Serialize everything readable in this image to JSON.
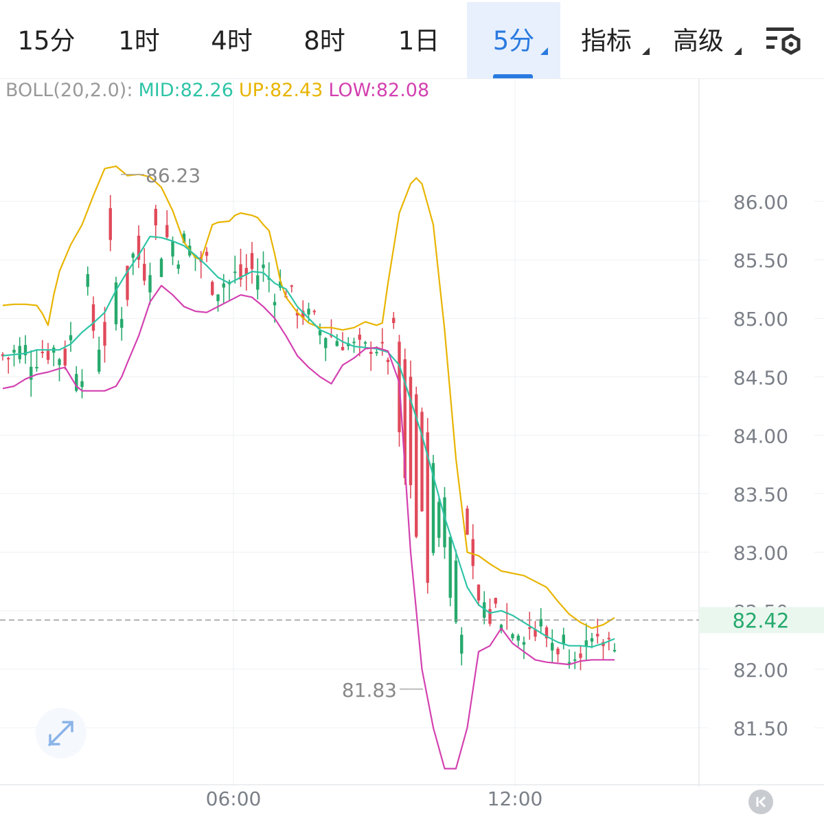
{
  "tabs": [
    {
      "label": "15分",
      "active": false,
      "dropdown": false
    },
    {
      "label": "1时",
      "active": false,
      "dropdown": false
    },
    {
      "label": "4时",
      "active": false,
      "dropdown": false
    },
    {
      "label": "8时",
      "active": false,
      "dropdown": false
    },
    {
      "label": "1日",
      "active": false,
      "dropdown": false
    },
    {
      "label": "5分",
      "active": true,
      "dropdown": true
    },
    {
      "label": "指标",
      "active": false,
      "dropdown": true
    },
    {
      "label": "高级",
      "active": false,
      "dropdown": true
    }
  ],
  "settings_icon": "chart-settings-gear-icon",
  "indicator": {
    "name": "BOLL(20,2.0):",
    "mid": "MID:82.26",
    "up": "UP:82.43",
    "low": "LOW:82.08",
    "colors": {
      "name": "#999999",
      "mid": "#2ec4a6",
      "up": "#e8b400",
      "low": "#d341b0"
    }
  },
  "expand_icon": "expand-arrows-icon",
  "collapse_icon": "collapse-left-icon",
  "chart_data": {
    "type": "candlestick",
    "interval": "5分",
    "y_axis_ticks": [
      "86.00",
      "85.50",
      "85.00",
      "84.50",
      "84.00",
      "83.50",
      "83.00",
      "82.50",
      "82.00",
      "81.50"
    ],
    "ylim": [
      81.0,
      87.0
    ],
    "x_axis_ticks": [
      "06:00",
      "12:00"
    ],
    "current_price": "82.42",
    "high_label": "86.23",
    "low_label": "81.83",
    "colors": {
      "up": "#26a96c",
      "down": "#e04a5a",
      "mid": "#2ec4a6",
      "upper": "#e8b400",
      "lower": "#d341b0",
      "current": "#26a96c"
    },
    "series": [
      {
        "name": "UP",
        "points": [
          [
            0,
            85.11
          ],
          [
            2,
            85.12
          ],
          [
            4,
            85.12
          ],
          [
            6,
            85.11
          ],
          [
            7,
            85.04
          ],
          [
            8,
            84.94
          ],
          [
            9,
            85.2
          ],
          [
            10,
            85.4
          ],
          [
            12,
            85.63
          ],
          [
            14,
            85.8
          ],
          [
            16,
            86.05
          ],
          [
            18,
            86.28
          ],
          [
            20,
            86.3
          ],
          [
            22,
            86.22
          ],
          [
            24,
            86.23
          ],
          [
            26,
            86.21
          ],
          [
            28,
            86.12
          ],
          [
            30,
            85.92
          ],
          [
            32,
            85.65
          ],
          [
            34,
            85.52
          ],
          [
            35,
            85.5
          ],
          [
            36,
            85.65
          ],
          [
            37,
            85.8
          ],
          [
            38,
            85.82
          ],
          [
            40,
            85.83
          ],
          [
            41,
            85.88
          ],
          [
            42,
            85.9
          ],
          [
            44,
            85.88
          ],
          [
            45,
            85.86
          ],
          [
            46,
            85.8
          ],
          [
            47,
            85.75
          ],
          [
            48,
            85.55
          ],
          [
            49,
            85.32
          ],
          [
            50,
            85.18
          ],
          [
            52,
            85.05
          ],
          [
            54,
            84.96
          ],
          [
            56,
            84.92
          ],
          [
            58,
            84.92
          ],
          [
            60,
            84.9
          ],
          [
            62,
            84.92
          ],
          [
            64,
            84.97
          ],
          [
            66,
            84.94
          ],
          [
            67,
            84.96
          ],
          [
            68,
            85.3
          ],
          [
            70,
            85.9
          ],
          [
            72,
            86.15
          ],
          [
            73,
            86.2
          ],
          [
            74,
            86.15
          ],
          [
            76,
            85.8
          ],
          [
            78,
            84.9
          ],
          [
            80,
            83.8
          ],
          [
            82,
            83.0
          ],
          [
            84,
            82.97
          ],
          [
            86,
            82.9
          ],
          [
            88,
            82.84
          ],
          [
            90,
            82.82
          ],
          [
            92,
            82.8
          ],
          [
            94,
            82.75
          ],
          [
            96,
            82.7
          ],
          [
            98,
            82.58
          ],
          [
            100,
            82.47
          ],
          [
            102,
            82.4
          ],
          [
            104,
            82.35
          ],
          [
            106,
            82.38
          ],
          [
            108,
            82.44
          ]
        ]
      },
      {
        "name": "MID",
        "points": [
          [
            0,
            84.68
          ],
          [
            4,
            84.7
          ],
          [
            6,
            84.73
          ],
          [
            8,
            84.73
          ],
          [
            10,
            84.73
          ],
          [
            12,
            84.78
          ],
          [
            14,
            84.88
          ],
          [
            16,
            84.96
          ],
          [
            18,
            85.05
          ],
          [
            20,
            85.24
          ],
          [
            22,
            85.4
          ],
          [
            24,
            85.54
          ],
          [
            26,
            85.7
          ],
          [
            28,
            85.69
          ],
          [
            30,
            85.66
          ],
          [
            32,
            85.62
          ],
          [
            34,
            85.54
          ],
          [
            36,
            85.45
          ],
          [
            38,
            85.35
          ],
          [
            40,
            85.3
          ],
          [
            42,
            85.35
          ],
          [
            44,
            85.4
          ],
          [
            46,
            85.39
          ],
          [
            48,
            85.3
          ],
          [
            50,
            85.25
          ],
          [
            52,
            85.1
          ],
          [
            54,
            85.0
          ],
          [
            56,
            84.9
          ],
          [
            58,
            84.86
          ],
          [
            60,
            84.8
          ],
          [
            62,
            84.76
          ],
          [
            64,
            84.75
          ],
          [
            66,
            84.74
          ],
          [
            68,
            84.71
          ],
          [
            70,
            84.6
          ],
          [
            72,
            84.3
          ],
          [
            74,
            84.0
          ],
          [
            76,
            83.65
          ],
          [
            78,
            83.3
          ],
          [
            80,
            83.0
          ],
          [
            82,
            82.7
          ],
          [
            84,
            82.55
          ],
          [
            86,
            82.48
          ],
          [
            88,
            82.5
          ],
          [
            90,
            82.46
          ],
          [
            92,
            82.4
          ],
          [
            94,
            82.34
          ],
          [
            96,
            82.28
          ],
          [
            98,
            82.23
          ],
          [
            100,
            82.2
          ],
          [
            102,
            82.2
          ],
          [
            104,
            82.19
          ],
          [
            106,
            82.22
          ],
          [
            108,
            82.26
          ]
        ]
      },
      {
        "name": "LOW",
        "points": [
          [
            0,
            84.4
          ],
          [
            2,
            84.42
          ],
          [
            4,
            84.48
          ],
          [
            6,
            84.52
          ],
          [
            8,
            84.54
          ],
          [
            10,
            84.57
          ],
          [
            11,
            84.58
          ],
          [
            12,
            84.5
          ],
          [
            13,
            84.42
          ],
          [
            14,
            84.38
          ],
          [
            16,
            84.38
          ],
          [
            18,
            84.38
          ],
          [
            20,
            84.42
          ],
          [
            21,
            84.5
          ],
          [
            22,
            84.62
          ],
          [
            24,
            84.85
          ],
          [
            26,
            85.14
          ],
          [
            28,
            85.28
          ],
          [
            30,
            85.2
          ],
          [
            32,
            85.1
          ],
          [
            34,
            85.06
          ],
          [
            36,
            85.05
          ],
          [
            38,
            85.1
          ],
          [
            40,
            85.15
          ],
          [
            42,
            85.2
          ],
          [
            44,
            85.18
          ],
          [
            46,
            85.1
          ],
          [
            48,
            85.0
          ],
          [
            50,
            84.85
          ],
          [
            52,
            84.68
          ],
          [
            54,
            84.58
          ],
          [
            56,
            84.5
          ],
          [
            58,
            84.44
          ],
          [
            60,
            84.6
          ],
          [
            62,
            84.66
          ],
          [
            64,
            84.74
          ],
          [
            66,
            84.75
          ],
          [
            68,
            84.72
          ],
          [
            70,
            84.45
          ],
          [
            72,
            83.0
          ],
          [
            74,
            82.0
          ],
          [
            76,
            81.5
          ],
          [
            78,
            81.15
          ],
          [
            80,
            81.15
          ],
          [
            82,
            81.5
          ],
          [
            84,
            82.15
          ],
          [
            86,
            82.2
          ],
          [
            88,
            82.35
          ],
          [
            90,
            82.22
          ],
          [
            92,
            82.15
          ],
          [
            94,
            82.08
          ],
          [
            96,
            82.06
          ],
          [
            98,
            82.05
          ],
          [
            100,
            82.04
          ],
          [
            102,
            82.07
          ],
          [
            104,
            82.08
          ],
          [
            106,
            82.08
          ],
          [
            108,
            82.08
          ]
        ]
      }
    ]
  }
}
